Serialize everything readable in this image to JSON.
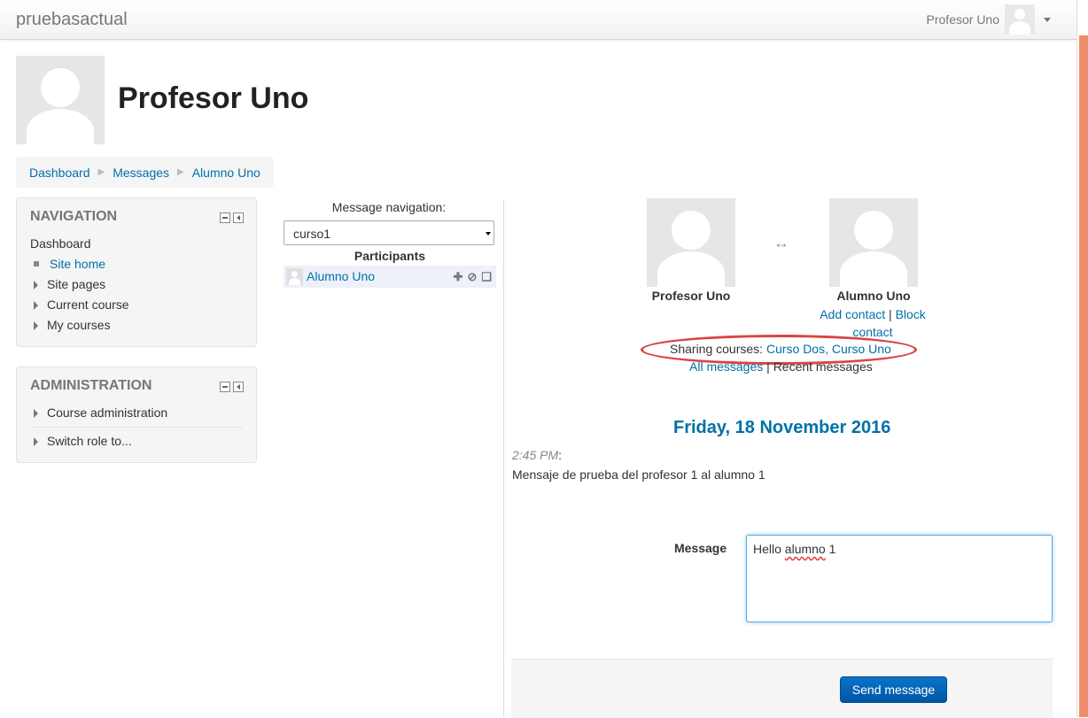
{
  "navbar": {
    "brand": "pruebasactual",
    "user_name": "Profesor Uno"
  },
  "header": {
    "title": "Profesor Uno"
  },
  "breadcrumb": [
    "Dashboard",
    "Messages",
    "Alumno Uno"
  ],
  "navigation_block": {
    "title": "NAVIGATION",
    "items": [
      "Dashboard",
      "Site home",
      "Site pages",
      "Current course",
      "My courses"
    ]
  },
  "administration_block": {
    "title": "ADMINISTRATION",
    "items": [
      "Course administration",
      "Switch role to..."
    ]
  },
  "message_nav": {
    "label": "Message navigation:",
    "selected": "curso1",
    "participants_header": "Participants",
    "participant": "Alumno Uno"
  },
  "conversation": {
    "user_left": "Profesor Uno",
    "user_right": "Alumno Uno",
    "add_contact": "Add contact",
    "separator": "|",
    "block_contact": "Block contact",
    "sharing_label": "Sharing courses:",
    "course_1": "Curso Dos",
    "course_sep": ",",
    "course_2": "Curso Uno",
    "all_messages": "All messages",
    "recent_messages": "Recent messages",
    "date": "Friday, 18 November 2016",
    "time": "2:45 PM",
    "time_colon": ":",
    "message_text": "Mensaje de prueba del profesor 1 al alumno 1"
  },
  "compose": {
    "label": "Message",
    "value_word1": "Hello",
    "value_word2": "alumno",
    "value_word3": "1",
    "send_label": "Send message"
  },
  "colors": {
    "link": "#0070a8",
    "primary_button": "#0061b6",
    "annotation_oval": "#d94545"
  },
  "icons": [
    "user-avatar",
    "caret-down-icon",
    "minimize-icon",
    "dock-icon",
    "add-contact-icon",
    "block-icon",
    "history-icon",
    "swap-arrows-icon"
  ]
}
